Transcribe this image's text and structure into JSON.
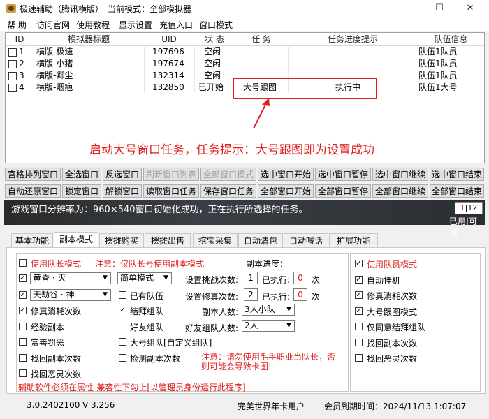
{
  "window": {
    "title": "极速辅助（腾讯横版）",
    "mode_label": "当前模式：全部模拟器",
    "controls": [
      "—",
      "☐",
      "✕"
    ]
  },
  "menu": [
    "帮 助",
    "访问官网",
    "使用教程",
    "显示设置",
    "充值入口",
    "窗口模式"
  ],
  "list": {
    "headers": [
      "ID",
      "模拟器标题",
      "UID",
      "状 态",
      "任 务",
      "任务进度提示",
      "队伍信息"
    ],
    "rows": [
      {
        "id": "1",
        "title": "横版-极速",
        "uid": "197696",
        "status": "空闲",
        "task": "",
        "progress": "",
        "team": "队伍1队员"
      },
      {
        "id": "2",
        "title": "横版-小猪",
        "uid": "197674",
        "status": "空闲",
        "task": "",
        "progress": "",
        "team": "队伍1队员"
      },
      {
        "id": "3",
        "title": "横版-卿尘",
        "uid": "132314",
        "status": "空闲",
        "task": "",
        "progress": "",
        "team": "队伍1队员"
      },
      {
        "id": "4",
        "title": "横版-烟疤",
        "uid": "132850",
        "status": "已开始",
        "task": "大号跟图",
        "progress": "执行中",
        "team": "队伍1大号"
      }
    ]
  },
  "annotation": "启动大号窗口任务，任务提示：大号跟图即为设置成功",
  "buttons_row1": [
    "宫格排列窗口",
    "全选窗口",
    "反选窗口",
    "刷新窗口列表",
    "全部窗口模式",
    "选中窗口开始",
    "选中窗口暂停",
    "选中窗口继续",
    "选中窗口结束"
  ],
  "buttons_row2": [
    "自动还原窗口",
    "锁定窗口",
    "解锁窗口",
    "读取窗口任务",
    "保存窗口任务",
    "全部窗口开始",
    "全部窗口暂停",
    "全部窗口继续",
    "全部窗口结束"
  ],
  "status": {
    "message": "游戏窗口分辨率为：960×540窗口初始化成功，正在执行所选择的任务。",
    "page_current": "1",
    "page_total": "12",
    "used_label": "已用",
    "avail_label": "可用"
  },
  "tabs": [
    "基本功能",
    "副本模式",
    "摆摊购买",
    "摆摊出售",
    "挖宝采集",
    "自动清包",
    "自动喊话",
    "扩展功能"
  ],
  "dungeon": {
    "use_leader": "使用队长模式",
    "leader_note": "注意：仅队长号使用副本模式",
    "progress_label": "副本进度：",
    "dungeon1": "黄昏 · 灭",
    "dungeon2": "天劫谷 · 神",
    "difficulty": "简单模式",
    "has_team": "已有队伍",
    "challenge_label": "设置挑战次数:",
    "challenge_val": "1",
    "repair_label": "设置修真次数:",
    "repair_val": "2",
    "executed_label": "已执行:",
    "executed1": "0",
    "executed2": "0",
    "times": "次",
    "repair_count": "修真消耗次数",
    "form_team": "结拜组队",
    "people_label": "副本人数:",
    "people_val": "3人小队",
    "exp_dungeon": "经验副本",
    "friend_team": "好友组队",
    "friend_people_label": "好友组队人数:",
    "friend_people_val": "2人",
    "reward": "赏善罚恶",
    "big_team": "大号组队[自定义组队]",
    "recover_dungeon": "找回副本次数",
    "check_dungeon": "检测副本次数",
    "recover_spirit": "找回恶灵次数",
    "warn": "注意：请勿使用毛手职业当队长，否则可能会导致卡图!",
    "admin_note": "辅助软件必须在属性-兼容性下勾上[以管理员身份运行此程序]",
    "right": [
      {
        "label": "使用队员模式",
        "red": true,
        "checked": true
      },
      {
        "label": "自动挂机",
        "red": false,
        "checked": true
      },
      {
        "label": "修真消耗次数",
        "red": false,
        "checked": true
      },
      {
        "label": "大号跟图模式",
        "red": false,
        "checked": true
      },
      {
        "label": "仅同意结拜组队",
        "red": false,
        "checked": false
      },
      {
        "label": "找回副本次数",
        "red": false,
        "checked": false
      },
      {
        "label": "找回恶灵次数",
        "red": false,
        "checked": false
      }
    ]
  },
  "footer": {
    "version1": "3.0.2402100",
    "version2": "V 3.256",
    "user": "完美世界年卡用户",
    "expiry": "会员到期时间：2024/11/13 1:07:07"
  }
}
